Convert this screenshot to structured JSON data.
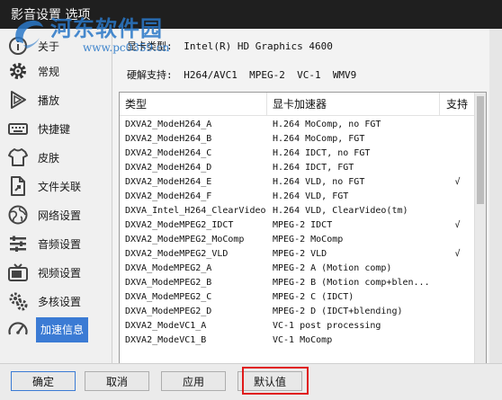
{
  "window": {
    "title": "影音设置 选项"
  },
  "watermark": {
    "text": "河东软件园",
    "url": "www.pc0359.cn"
  },
  "sidebar": {
    "items": [
      {
        "label": "关于",
        "icon": "info-icon"
      },
      {
        "label": "常规",
        "icon": "gear-icon"
      },
      {
        "label": "播放",
        "icon": "play-icon"
      },
      {
        "label": "快捷键",
        "icon": "keyboard-icon"
      },
      {
        "label": "皮肤",
        "icon": "shirt-icon"
      },
      {
        "label": "文件关联",
        "icon": "file-link-icon"
      },
      {
        "label": "网络设置",
        "icon": "globe-icon"
      },
      {
        "label": "音频设置",
        "icon": "audio-icon"
      },
      {
        "label": "视频设置",
        "icon": "tv-icon"
      },
      {
        "label": "多核设置",
        "icon": "cpu-icon"
      },
      {
        "label": "加速信息",
        "icon": "speedometer-icon"
      }
    ],
    "active": "加速信息"
  },
  "info": {
    "gpu_label": "显卡类型:",
    "gpu_value": "Intel(R) HD Graphics 4600",
    "hw_label": "硬解支持:",
    "hw_value": "H264/AVC1  MPEG-2  VC-1  WMV9"
  },
  "table": {
    "headers": [
      "类型",
      "显卡加速器",
      "支持"
    ],
    "rows": [
      [
        "DXVA2_ModeH264_A",
        "H.264 MoComp, no FGT",
        ""
      ],
      [
        "DXVA2_ModeH264_B",
        "H.264 MoComp, FGT",
        ""
      ],
      [
        "DXVA2_ModeH264_C",
        "H.264 IDCT, no FGT",
        ""
      ],
      [
        "DXVA2_ModeH264_D",
        "H.264 IDCT, FGT",
        ""
      ],
      [
        "DXVA2_ModeH264_E",
        "H.264 VLD, no FGT",
        "√"
      ],
      [
        "DXVA2_ModeH264_F",
        "H.264 VLD, FGT",
        ""
      ],
      [
        "DXVA_Intel_H264_ClearVideo",
        "H.264 VLD, ClearVideo(tm)",
        ""
      ],
      [
        "DXVA2_ModeMPEG2_IDCT",
        "MPEG-2 IDCT",
        "√"
      ],
      [
        "DXVA2_ModeMPEG2_MoComp",
        "MPEG-2 MoComp",
        ""
      ],
      [
        "DXVA2_ModeMPEG2_VLD",
        "MPEG-2 VLD",
        "√"
      ],
      [
        "DXVA_ModeMPEG2_A",
        "MPEG-2 A (Motion comp)",
        ""
      ],
      [
        "DXVA_ModeMPEG2_B",
        "MPEG-2 B (Motion comp+blen...",
        ""
      ],
      [
        "DXVA_ModeMPEG2_C",
        "MPEG-2 C (IDCT)",
        ""
      ],
      [
        "DXVA_ModeMPEG2_D",
        "MPEG-2 D (IDCT+blending)",
        ""
      ],
      [
        "DXVA2_ModeVC1_A",
        "VC-1 post processing",
        ""
      ],
      [
        "DXVA2_ModeVC1_B",
        "VC-1 MoComp",
        ""
      ]
    ]
  },
  "buttons": {
    "ok": "确定",
    "cancel": "取消",
    "apply": "应用",
    "default": "默认值"
  },
  "colors": {
    "accent": "#3b7bd4",
    "highlight": "#e01b1b",
    "watermark": "#2a78c8"
  }
}
